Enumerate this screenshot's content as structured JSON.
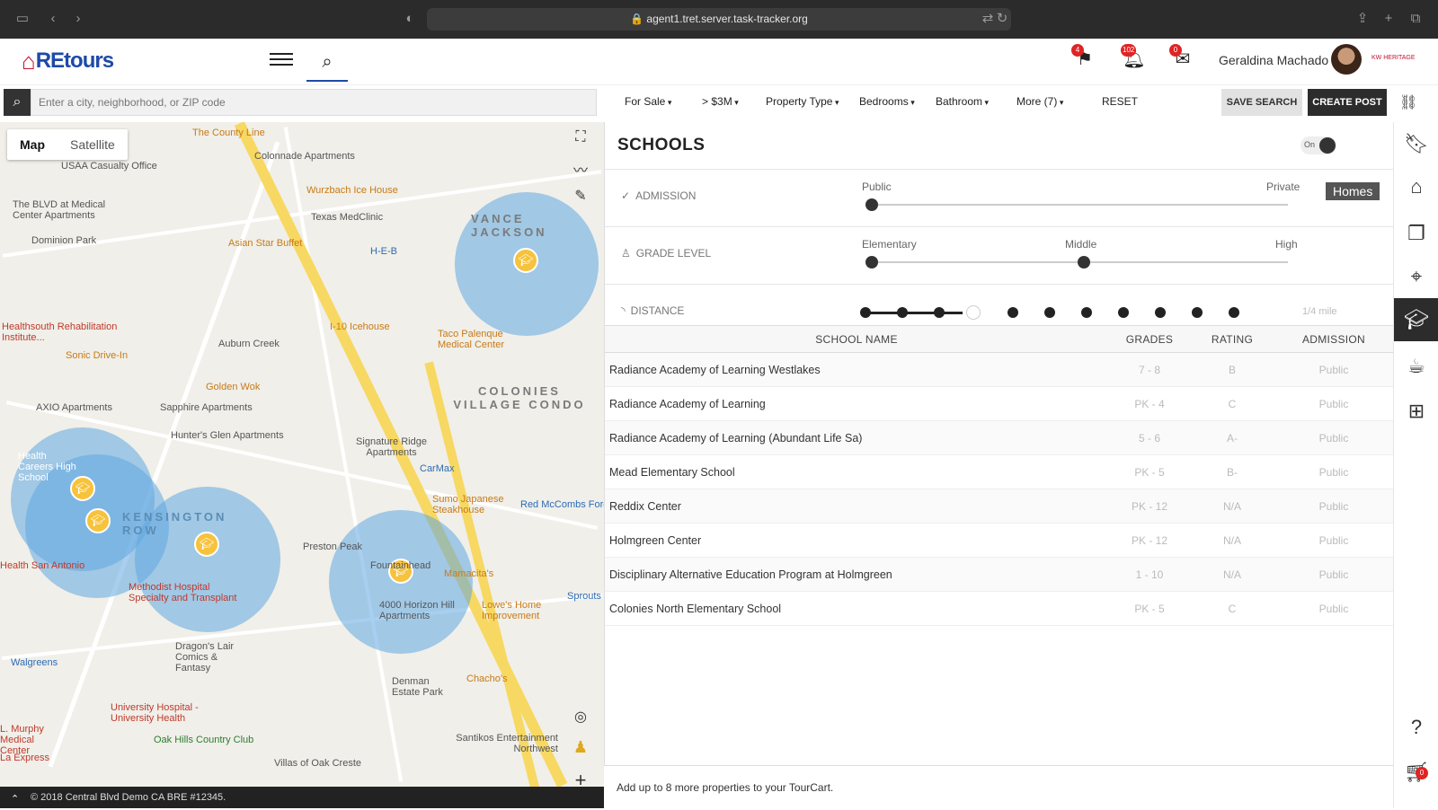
{
  "browser": {
    "url": "agent1.tret.server.task-tracker.org"
  },
  "header": {
    "logo_text": "REtours",
    "notifications": [
      {
        "icon": "tour-icon",
        "count": "4"
      },
      {
        "icon": "bell-icon",
        "count": "102"
      },
      {
        "icon": "chat-icon",
        "count": "0"
      }
    ],
    "user_name": "Geraldina Machado",
    "brand_mini": "KW HERITAGE"
  },
  "search": {
    "placeholder": "Enter a city, neighborhood, or ZIP code"
  },
  "filters": {
    "for_sale": "For Sale",
    "price": "> $3M",
    "property_type": "Property Type",
    "bedrooms": "Bedrooms",
    "bathroom": "Bathroom",
    "more": "More (7)",
    "reset": "RESET",
    "save_search": "SAVE SEARCH",
    "create_post": "CREATE POST"
  },
  "map": {
    "tabs": [
      "Map",
      "Satellite"
    ],
    "active_tab": "Map",
    "copyright": "© 2018 Central Blvd Demo CA BRE #12345.",
    "labels": {
      "county_line": "The County Line",
      "colonnade": "Colonnade Apartments",
      "usaa": "USAA Casualty Office",
      "wurzbach": "Wurzbach Ice House",
      "blvd_medical": "The BLVD at Medical Center Apartments",
      "texas_medclinic": "Texas MedClinic",
      "vance_jackson": "VANCE JACKSON",
      "dominion_park": "Dominion Park",
      "asian_star": "Asian Star Buffet",
      "heb": "H-E-B",
      "healthsouth": "Healthsouth Rehabilitation Institute...",
      "auburn_creek": "Auburn Creek",
      "icehouse": "I-10 Icehouse",
      "taco_palenque": "Taco Palenque Medical Center",
      "sonic": "Sonic Drive-In",
      "golden_wok": "Golden Wok",
      "colonies": "COLONIES VILLAGE CONDO",
      "axio": "AXIO Apartments",
      "sapphire": "Sapphire Apartments",
      "hunters_glen": "Hunter's Glen Apartments",
      "signature_ridge": "Signature Ridge Apartments",
      "carmax": "CarMax",
      "health_careers": "Health Careers High School",
      "sumo": "Sumo Japanese Steakhouse",
      "red_mccombs": "Red McCombs Ford",
      "kensington": "KENSINGTON ROW",
      "preston_peak": "Preston Peak",
      "fountainhead": "Fountainhead",
      "mamacitas": "Mamacita's",
      "health_san_antonio": "Health San Antonio",
      "methodist": "Methodist Hospital Specialty and Transplant",
      "horizon_hill": "4000 Horizon Hill Apartments",
      "lowes": "Lowe's Home Improvement",
      "sprouts": "Sprouts",
      "dragons_lair": "Dragon's Lair Comics & Fantasy",
      "walgreens": "Walgreens",
      "denman": "Denman Estate Park",
      "chachos": "Chacho's",
      "university_hospital": "University Hospital - University Health",
      "oak_hills": "Oak Hills Country Club",
      "santikos": "Santikos Entertainment Northwest",
      "villas": "Villas of Oak Creste",
      "murphy": "L. Murphy Medical Center",
      "la_express": "La Express"
    }
  },
  "schools_panel": {
    "title": "SCHOOLS",
    "toggle_label": "On",
    "admission_label": "ADMISSION",
    "admission_public": "Public",
    "admission_private": "Private",
    "homes_button": "Homes",
    "grade_label": "GRADE LEVEL",
    "grade_elementary": "Elementary",
    "grade_middle": "Middle",
    "grade_high": "High",
    "distance_label": "DISTANCE",
    "distance_value": "1/4 mile",
    "columns": [
      "SCHOOL NAME",
      "GRADES",
      "RATING",
      "ADMISSION"
    ],
    "rows": [
      {
        "name": "Radiance Academy of Learning Westlakes",
        "grades": "7 - 8",
        "rating": "B",
        "admission": "Public"
      },
      {
        "name": "Radiance Academy of Learning",
        "grades": "PK - 4",
        "rating": "C",
        "admission": "Public"
      },
      {
        "name": "Radiance Academy of Learning (Abundant Life Sa)",
        "grades": "5 - 6",
        "rating": "A-",
        "admission": "Public"
      },
      {
        "name": "Mead Elementary School",
        "grades": "PK - 5",
        "rating": "B-",
        "admission": "Public"
      },
      {
        "name": "Reddix Center",
        "grades": "PK - 12",
        "rating": "N/A",
        "admission": "Public"
      },
      {
        "name": "Holmgreen Center",
        "grades": "PK - 12",
        "rating": "N/A",
        "admission": "Public"
      },
      {
        "name": "Disciplinary Alternative Education Program at Holmgreen",
        "grades": "1 - 10",
        "rating": "N/A",
        "admission": "Public"
      },
      {
        "name": "Colonies North Elementary School",
        "grades": "PK - 5",
        "rating": "C",
        "admission": "Public"
      }
    ]
  },
  "footer": {
    "tourcart_text": "Add up to 8 more properties to your TourCart.",
    "cart_count": "0"
  }
}
